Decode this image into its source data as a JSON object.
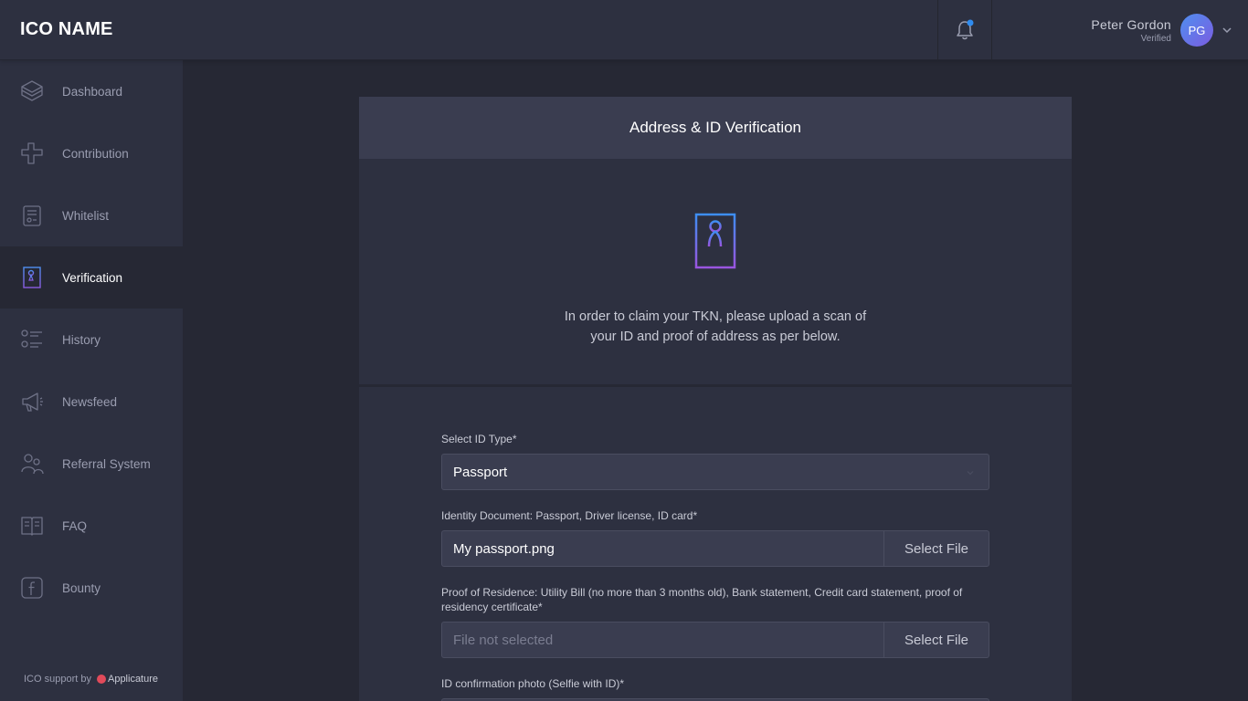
{
  "header": {
    "logo": "ICO NAME",
    "user_name": "Peter  Gordon",
    "user_status": "Verified",
    "avatar_initials": "PG"
  },
  "sidebar": {
    "items": [
      {
        "label": "Dashboard",
        "icon": "dashboard-icon"
      },
      {
        "label": "Contribution",
        "icon": "contribution-icon"
      },
      {
        "label": "Whitelist",
        "icon": "whitelist-icon"
      },
      {
        "label": "Verification",
        "icon": "verification-icon",
        "active": true
      },
      {
        "label": "History",
        "icon": "history-icon"
      },
      {
        "label": "Newsfeed",
        "icon": "megaphone-icon"
      },
      {
        "label": "Referral System",
        "icon": "referral-icon"
      },
      {
        "label": "FAQ",
        "icon": "book-icon"
      },
      {
        "label": "Bounty",
        "icon": "facebook-icon"
      }
    ],
    "footer_prefix": "ICO support by",
    "footer_brand": "Applicature"
  },
  "card": {
    "title": "Address & ID Verification",
    "intro": "In order to claim your TKN, please upload a scan of your ID and proof of address as per below."
  },
  "form": {
    "id_type_label": "Select ID Type*",
    "id_type_value": "Passport",
    "identity_label": "Identity Document: Passport, Driver license, ID card*",
    "identity_file": "My passport.png",
    "select_file": "Select File",
    "residence_label": "Proof of Residence: Utility Bill (no more than 3 months old), Bank statement, Credit card statement, proof of residency certificate*",
    "residence_file": "File not selected",
    "selfie_label": "ID confirmation photo (Selfie with ID)*"
  },
  "colors": {
    "accent_blue": "#4f8ff0",
    "accent_purple": "#7b5ce0",
    "notification_dot": "#2f8cf0"
  }
}
